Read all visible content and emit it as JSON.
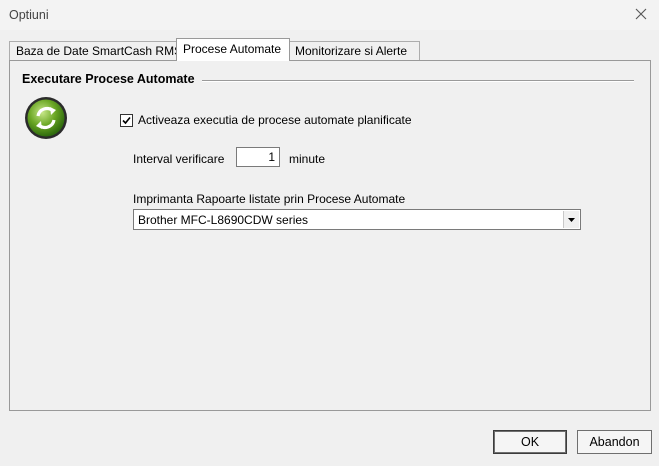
{
  "window": {
    "title": "Optiuni"
  },
  "tabs": [
    {
      "label": "Baza de Date SmartCash RMS",
      "active": false
    },
    {
      "label": "Procese Automate",
      "active": true
    },
    {
      "label": "Monitorizare si Alerte",
      "active": false
    }
  ],
  "group": {
    "title": "Executare Procese Automate",
    "icon": "refresh-icon"
  },
  "enable": {
    "label": "Activeaza executia de procese automate planificate",
    "checked": true
  },
  "interval": {
    "label": "Interval verificare",
    "value": "1",
    "unit": "minute"
  },
  "printer": {
    "label": "Imprimanta Rapoarte listate prin Procese Automate",
    "selected": "Brother MFC-L8690CDW series"
  },
  "buttons": {
    "ok": "OK",
    "cancel": "Abandon"
  }
}
